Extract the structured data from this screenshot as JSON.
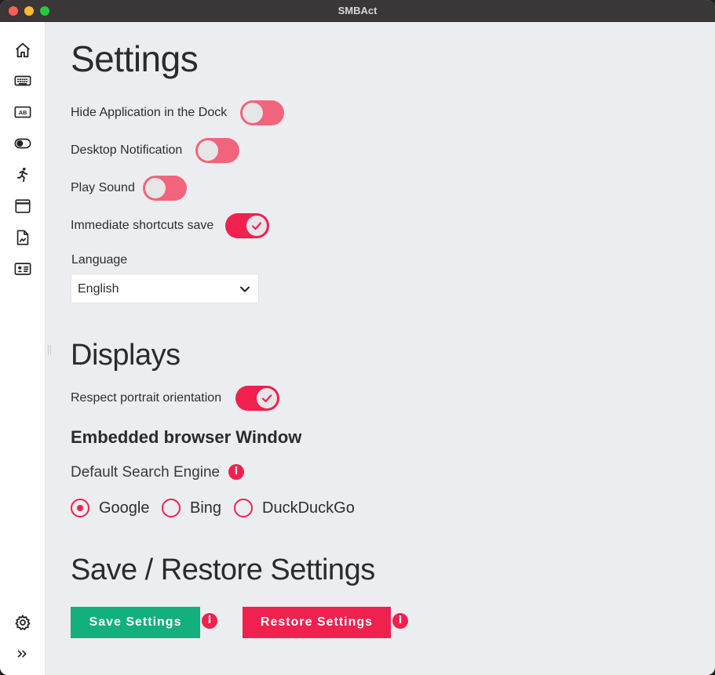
{
  "window": {
    "title": "SMBAct"
  },
  "sidebar": {
    "items": [
      {
        "icon": "home-icon"
      },
      {
        "icon": "keyboard-icon"
      },
      {
        "icon": "text-ab-icon"
      },
      {
        "icon": "toggle-icon"
      },
      {
        "icon": "running-person-icon"
      },
      {
        "icon": "browser-window-icon"
      },
      {
        "icon": "document-image-icon"
      },
      {
        "icon": "contact-card-icon"
      }
    ],
    "bottom": [
      {
        "icon": "gear-icon"
      },
      {
        "icon": "double-chevron-right-icon"
      }
    ]
  },
  "settings": {
    "heading": "Settings",
    "toggles": [
      {
        "label": "Hide Application in the Dock",
        "on": false
      },
      {
        "label": "Desktop Notification",
        "on": false
      },
      {
        "label": "Play Sound",
        "on": false
      },
      {
        "label": "Immediate shortcuts save",
        "on": true
      }
    ],
    "language": {
      "label": "Language",
      "value": "English"
    }
  },
  "displays": {
    "heading": "Displays",
    "toggle": {
      "label": "Respect portrait orientation",
      "on": true
    }
  },
  "browser": {
    "heading": "Embedded browser Window",
    "search_label": "Default Search Engine",
    "info_glyph": "i",
    "engines": [
      {
        "label": "Google",
        "checked": true
      },
      {
        "label": "Bing",
        "checked": false
      },
      {
        "label": "DuckDuckGo",
        "checked": false
      }
    ]
  },
  "save_restore": {
    "heading": "Save / Restore Settings",
    "save_label": "Save Settings",
    "restore_label": "Restore Settings"
  },
  "colors": {
    "accent": "#f0204f",
    "toggle_off": "#f2647c",
    "save_button": "#12b07c",
    "background": "#ecedf0"
  }
}
